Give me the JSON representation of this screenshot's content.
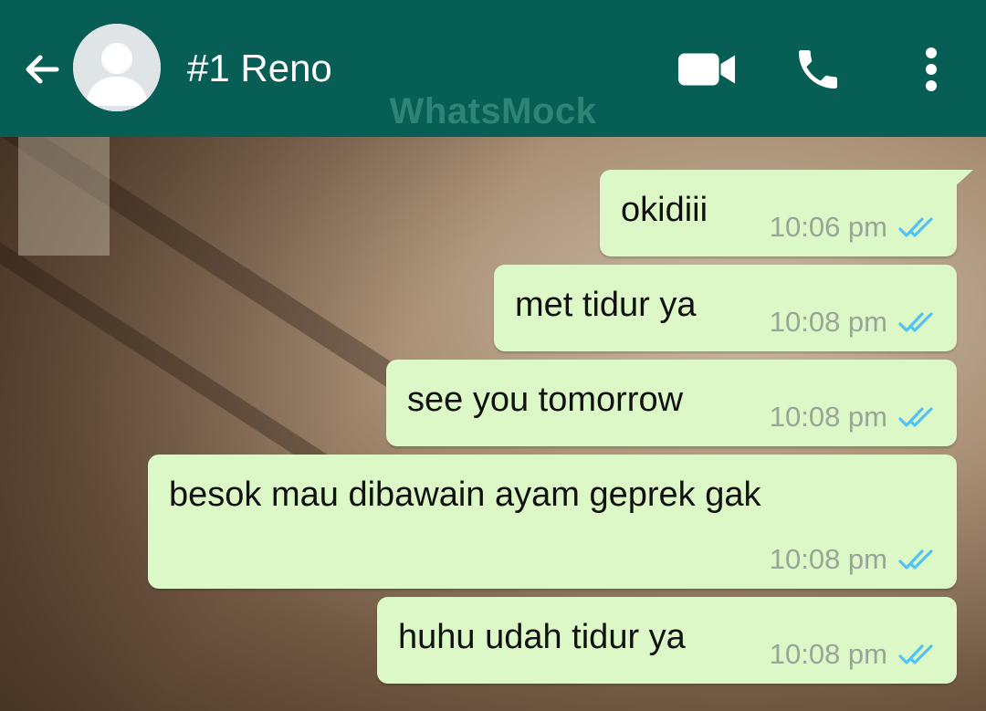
{
  "header": {
    "contact_name": "#1 Reno",
    "watermark": "WhatsMock",
    "bg_color": "#075e54",
    "icons": [
      "back-arrow-icon",
      "avatar-placeholder",
      "video-call-icon",
      "phone-icon",
      "more-vert-icon"
    ]
  },
  "messages": [
    {
      "text": "okidiii",
      "time": "10:06 pm",
      "status": "read"
    },
    {
      "text": "met tidur ya",
      "time": "10:08 pm",
      "status": "read"
    },
    {
      "text": "see you tomorrow",
      "time": "10:08 pm",
      "status": "read"
    },
    {
      "text": "besok mau dibawain ayam geprek gak",
      "time": "10:08 pm",
      "status": "read"
    },
    {
      "text": "huhu udah tidur ya",
      "time": "10:08 pm",
      "status": "read"
    }
  ],
  "colors": {
    "outgoing_bubble": "#dcf8c6",
    "read_tick": "#4fc3f7",
    "time_text": "#9aa59a"
  }
}
